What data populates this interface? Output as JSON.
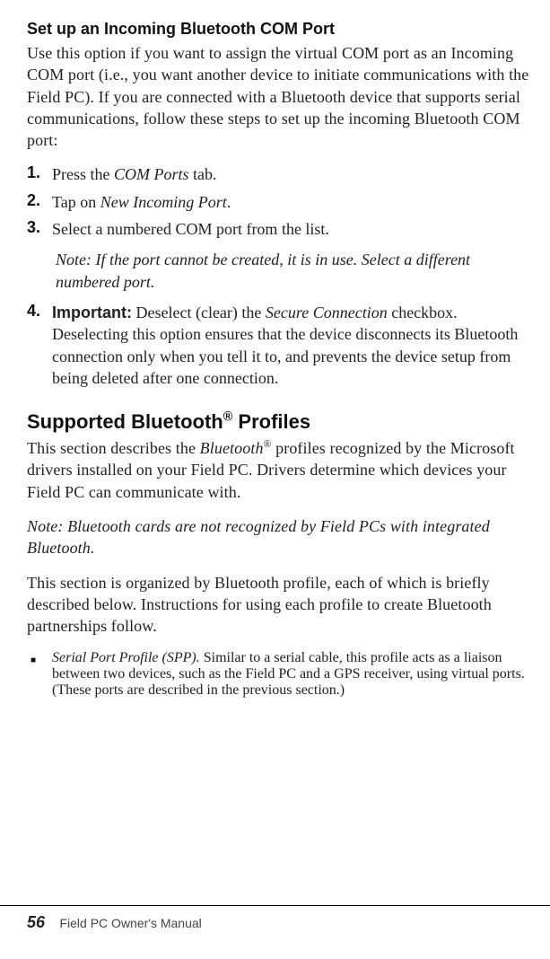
{
  "section1": {
    "heading": "Set up an Incoming Bluetooth COM Port",
    "intro": "Use this option if you want to assign the virtual COM port as an Incoming COM port (i.e., you want another device to initiate communications with the Field PC). If you are connected with a Bluetooth device that supports serial communications, follow these steps to set up the incoming Bluetooth COM port:",
    "steps": {
      "s1": {
        "num": "1.",
        "pre": "Press the ",
        "ital": "COM Ports",
        "post": " tab."
      },
      "s2": {
        "num": "2.",
        "pre": "Tap on ",
        "ital": "New Incoming Port",
        "post": "."
      },
      "s3": {
        "num": "3.",
        "text": "Select a numbered COM port from the list."
      },
      "s3_note": "Note: If the port cannot be created, it is in use. Select a different numbered port.",
      "s4": {
        "num": "4.",
        "important": "Important:",
        "pre": "  Deselect (clear) the ",
        "ital": "Secure Connection",
        "post": " checkbox. Deselecting this option ensures that the device disconnects its Bluetooth connection only when you tell it to, and prevents the device setup from being deleted after one connection."
      }
    }
  },
  "section2": {
    "heading_a": "Supported Bluetooth",
    "heading_mark": "®",
    "heading_b": " Profiles",
    "p1_a": "This section describes the ",
    "p1_ital": "Bluetooth",
    "p1_mark": "®",
    "p1_b": " profiles recognized by the Microsoft drivers installed on your Field PC. Drivers determine which devices your Field PC can communicate with.",
    "p2_note": "Note: Bluetooth cards are not recognized by Field PCs with integrated Bluetooth.",
    "p3": "This section is organized by Bluetooth profile, each of which is briefly described below. Instructions for using each profile to create Bluetooth partnerships follow.",
    "bullet1": {
      "ital": "Serial Port Profile (SPP).",
      "rest": " Similar to a serial cable, this profile acts as a liaison between two devices, such as the Field PC and a GPS receiver, using virtual ports. (These ports are described in the previous section.)"
    }
  },
  "footer": {
    "page": "56",
    "source": "Field PC Owner's Manual"
  }
}
